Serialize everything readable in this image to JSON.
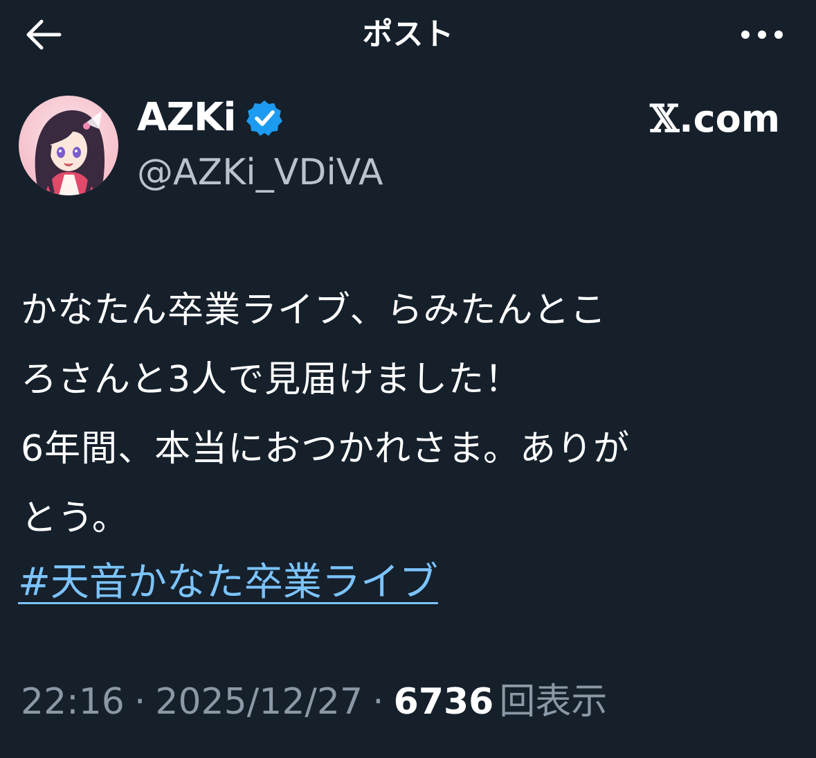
{
  "colors": {
    "background": "#15202b",
    "text": "#ffffff",
    "secondary_text": "#8b98a5",
    "handle_text": "#b8c3ce",
    "link": "#7cc4ff",
    "verified_badge": "#1d9bf0"
  },
  "header": {
    "back_icon": "arrow-left-icon",
    "title": "ポスト",
    "more_icon": "more-horizontal-icon"
  },
  "author": {
    "display_name": "AZKi",
    "verified_icon": "verified-badge-icon",
    "handle": "@AZKi_VDiVA",
    "source_x": "𝕏",
    "source_rest": ".com"
  },
  "tweet": {
    "lines": [
      "かなたん卒業ライブ、らみたんとこ",
      "ろさんと3人で見届けました！",
      "6年間、本当におつかれさま。ありが",
      "とう。"
    ],
    "hashtag": "#天音かなた卒業ライブ"
  },
  "meta": {
    "time": "22:16",
    "separator": "·",
    "date": "2025/12/27",
    "views_count": "6736",
    "views_label": "回表示"
  }
}
